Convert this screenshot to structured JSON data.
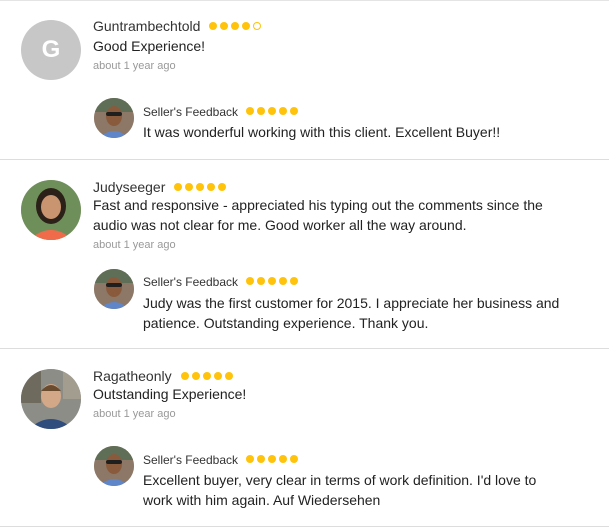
{
  "reviews": [
    {
      "name": "Guntrambechtold",
      "initial": "G",
      "rating": 4,
      "comment": "Good Experience!",
      "time": "about 1 year ago",
      "seller_feedback_label": "Seller's Feedback",
      "seller_rating": 5,
      "seller_comment": "It was wonderful working with this client. Excellent Buyer!!"
    },
    {
      "name": "Judyseeger",
      "rating": 5,
      "comment": "Fast and responsive - appreciated his typing out the comments since the audio was not clear for me. Good worker all the way around.",
      "time": "about 1 year ago",
      "seller_feedback_label": "Seller's Feedback",
      "seller_rating": 5,
      "seller_comment": "Judy was the first customer for 2015. I appreciate her business and patience. Outstanding experience. Thank you."
    },
    {
      "name": "Ragatheonly",
      "rating": 5,
      "comment": "Outstanding Experience!",
      "time": "about 1 year ago",
      "seller_feedback_label": "Seller's Feedback",
      "seller_rating": 5,
      "seller_comment": "Excellent buyer, very clear in terms of work definition. I'd love to work with him again. Auf Wiedersehen"
    }
  ],
  "colors": {
    "star": "#ffc30b",
    "meta": "#999999",
    "divider": "#dddddd"
  },
  "icons": {
    "rating": "star-icon"
  }
}
